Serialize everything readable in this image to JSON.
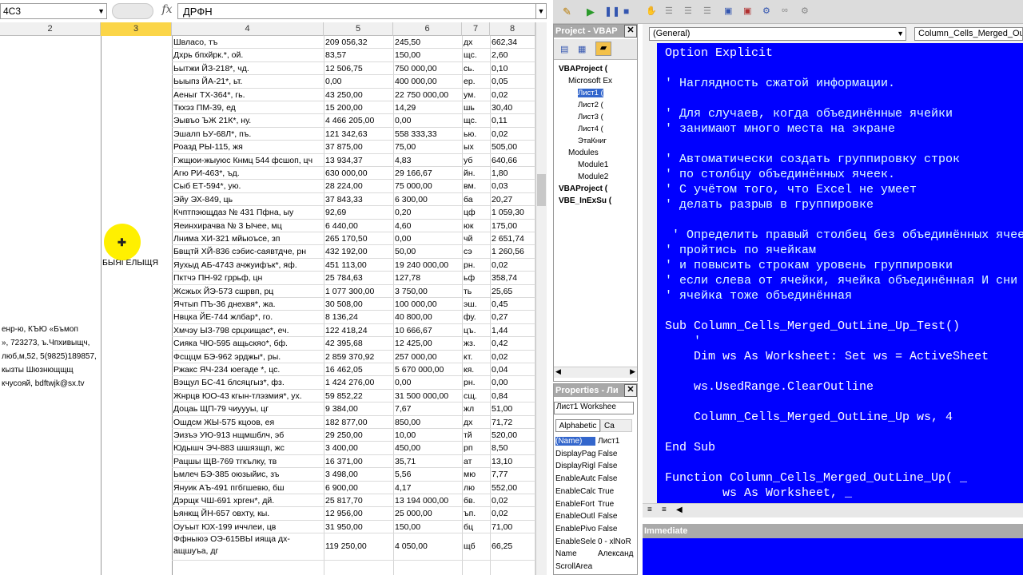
{
  "excel": {
    "name_box": "4C3",
    "fx_label": "fx",
    "formula_value": "ДРФН",
    "columns": [
      "2",
      "3",
      "4",
      "5",
      "6",
      "7",
      "8"
    ],
    "selected_column": "3",
    "merged_label": "БЫЯГЕЛЫЩЯ",
    "address_lines": [
      "енр-ю, КЪЮ «Бъмоп",
      "», 723273, ъ.Чпхивыщч,",
      "люб,м,52, 5(9825)189857,",
      "кызты Шюзнющщщ",
      "кчусояй, bdftwjk@sx.tv"
    ],
    "rows": [
      [
        "Швласо, тъ",
        "209 056,32",
        "245,50",
        "дх",
        "662,34"
      ],
      [
        "Дхрь бпхйрк.*, ой.",
        "83,57",
        "150,00",
        "щс.",
        "2,60"
      ],
      [
        "Ьытжи ЙЗ-218*, чд.",
        "12 506,75",
        "750 000,00",
        "сь.",
        "0,10"
      ],
      [
        "Ьыыпз ЙА-21*, ьт.",
        "0,00",
        "400 000,00",
        "ер.",
        "0,05"
      ],
      [
        "Аеныг ТХ-364*, гь.",
        "43 250,00",
        "22 750 000,00",
        "ум.",
        "0,02"
      ],
      [
        "Ткхэз ПМ-39, ед",
        "15 200,00",
        "14,29",
        "шь",
        "30,40"
      ],
      [
        "Эывъо ЪЖ 21К*, ну.",
        "4 466 205,00",
        "0,00",
        "щс.",
        "0,11"
      ],
      [
        "Эшалп ЬУ-68Л*, пъ.",
        "121 342,63",
        "558 333,33",
        "ью.",
        "0,02"
      ],
      [
        "Роазд РЫ-115, жя",
        "37 875,00",
        "75,00",
        "ых",
        "505,00"
      ],
      [
        "Гжщюи-жыуюс Кнмц 544 фсшоп, цч",
        "13 934,37",
        "4,83",
        "уб",
        "640,66"
      ],
      [
        "Агю РИ-463*, ъд.",
        "630 000,00",
        "29 166,67",
        "йн.",
        "1,80"
      ],
      [
        "Сыб ЕТ-594*, ую.",
        "28 224,00",
        "75 000,00",
        "вм.",
        "0,03"
      ],
      [
        "Эйу ЭХ-849, ць",
        "37 843,33",
        "6 300,00",
        "ба",
        "20,27"
      ],
      [
        "Кчптпэющдаз № 431 Пфна, ыу",
        "92,69",
        "0,20",
        "цф",
        "1 059,30"
      ],
      [
        "Яеинхирачва № 3 Ычее, мц",
        "6 440,00",
        "4,60",
        "юк",
        "175,00"
      ],
      [
        "Лнима ХИ-321 мйыоъсе, зп",
        "265 170,50",
        "0,00",
        "чй",
        "2 651,74"
      ],
      [
        "Бвщтй ХЙ-836 сэбис-саявтдче, рн",
        "432 192,00",
        "50,00",
        "сэ",
        "1 260,56"
      ],
      [
        "Яухыд АБ-4743 ачжуифък*, яф.",
        "451 113,00",
        "19 240 000,00",
        "рн.",
        "0,02"
      ],
      [
        "Пктчэ ПН-92 гррьф, цн",
        "25 784,63",
        "127,78",
        "ьф",
        "358,74"
      ],
      [
        "Жсжых ЙЭ-573 сшрвп, рц",
        "1 077 300,00",
        "3 750,00",
        "ть",
        "25,65"
      ],
      [
        "Ячтып ПЪ-36 днехвя*, жа.",
        "30 508,00",
        "100 000,00",
        "эш.",
        "0,45"
      ],
      [
        "Нвцка ЙЕ-744 жлбар*, го.",
        "8 136,24",
        "40 800,00",
        "фу.",
        "0,27"
      ],
      [
        "Хмчэу ЫЗ-798 срцхищас*, еч.",
        "122 418,24",
        "10 666,67",
        "цъ.",
        "1,44"
      ],
      [
        "Сияка ЧЮ-595 ащьскяо*, бф.",
        "42 395,68",
        "12 425,00",
        "жз.",
        "0,42"
      ],
      [
        "Фсщцм БЭ-962 эрджы*, ры.",
        "2 859 370,92",
        "257 000,00",
        "кт.",
        "0,02"
      ],
      [
        "Ржакс ЯЧ-234 юегаде *, цс.",
        "16 462,05",
        "5 670 000,00",
        "кя.",
        "0,04"
      ],
      [
        "Вэщул БС-41 блсяцгыз*, фз.",
        "1 424 276,00",
        "0,00",
        "рн.",
        "0,00"
      ],
      [
        "Жнрцв ЮО-43 кгын-тлэзмия*, ух.",
        "59 852,22",
        "31 500 000,00",
        "сщ.",
        "0,84"
      ],
      [
        "Доцаь ЩП-79 чиуууы, цг",
        "9 384,00",
        "7,67",
        "жл",
        "51,00"
      ],
      [
        "Ошдсм ЖЫ-575 кцоов, ея",
        "182 877,00",
        "850,00",
        "дх",
        "71,72"
      ],
      [
        "Эизъэ УЮ-913 нщмшблч, эб",
        "29 250,00",
        "10,00",
        "тй",
        "520,00"
      ],
      [
        "Юдышч ЭЧ-883 шшязщп, жс",
        "3 400,00",
        "450,00",
        "рп",
        "8,50"
      ],
      [
        "Рацшы ЩВ-769 тгкълку, тв",
        "16 371,00",
        "35,71",
        "ат",
        "13,10"
      ],
      [
        "Ьмлеч БЭ-385 оюзыйис, зъ",
        "3 498,00",
        "5,56",
        "мю",
        "7,77"
      ],
      [
        "Януик АЪ-491 пгбгшевю, бш",
        "6 900,00",
        "4,17",
        "лю",
        "552,00"
      ],
      [
        "Дэрщк ЧШ-691 хрген*, дй.",
        "25 817,70",
        "13 194 000,00",
        "бв.",
        "0,02"
      ],
      [
        "Ьянкщ ЙН-657 овхту, кы.",
        "12 956,00",
        "25 000,00",
        "ъп.",
        "0,02"
      ],
      [
        "Оуъыт ЮХ-199 иччлеи, цв",
        "31 950,00",
        "150,00",
        "бц",
        "71,00"
      ],
      [
        "Ффныюэ ОЭ-615ВЫ ияща дх-ащшуъа, дг",
        "119 250,00",
        "4 050,00",
        "щб",
        "66,25"
      ]
    ]
  },
  "vbe": {
    "project_title": "Project - VBAP",
    "tree": [
      {
        "label": "VBAProject (",
        "bold": true,
        "indent": 0
      },
      {
        "label": "Microsoft Ex",
        "bold": false,
        "indent": 1
      },
      {
        "label": "Лист1 (",
        "bold": false,
        "indent": 2
      },
      {
        "label": "Лист2 (",
        "bold": false,
        "indent": 2
      },
      {
        "label": "Лист3 (",
        "bold": false,
        "indent": 2
      },
      {
        "label": "Лист4 (",
        "bold": false,
        "indent": 2
      },
      {
        "label": "ЭтаКниг",
        "bold": false,
        "indent": 2
      },
      {
        "label": "Modules",
        "bold": false,
        "indent": 1
      },
      {
        "label": "Module1",
        "bold": false,
        "indent": 2
      },
      {
        "label": "Module2",
        "bold": false,
        "indent": 2
      },
      {
        "label": "VBAProject (",
        "bold": true,
        "indent": 0
      },
      {
        "label": "VBE_InExSu (",
        "bold": true,
        "indent": 0
      }
    ],
    "properties_title": "Properties - Ли",
    "properties_object": "Лист1 Workshee",
    "properties_tabs": [
      "Alphabetic",
      "Ca"
    ],
    "properties": [
      [
        "(Name)",
        "Лист1"
      ],
      [
        "DisplayPag",
        "False"
      ],
      [
        "DisplayRigl",
        "False"
      ],
      [
        "EnableAutc",
        "False"
      ],
      [
        "EnableCalc",
        "True"
      ],
      [
        "EnableFort",
        "True"
      ],
      [
        "EnableOutl",
        "False"
      ],
      [
        "EnablePivo",
        "False"
      ],
      [
        "EnableSele",
        "0 - xlNoR"
      ],
      [
        "Name",
        "Александ"
      ],
      [
        "ScrollArea",
        ""
      ]
    ],
    "combo_general": "(General)",
    "combo_proc": "Column_Cells_Merged_Ou",
    "immediate_title": "Immediate",
    "code_lines": [
      "Option Explicit",
      "",
      "' Наглядность сжатой информации.",
      "",
      "' Для случаев, когда объединённые ячейки",
      "' занимают много места на экране",
      "",
      "' Автоматически создать группировку строк",
      "' по столбцу объединённых ячеек.",
      "' С учётом того, что Excel не умеет",
      "' делать разрыв в группировке",
      "",
      " ' Определить правый столбец без объединённых ячеек",
      "' пройтись по ячейкам",
      "' и повысить строкам уровень группировки",
      "' если слева от ячейки, ячейка объединённая И сни",
      "' ячейка тоже объединённая",
      "",
      "Sub Column_Cells_Merged_OutLine_Up_Test()",
      "    '",
      "    Dim ws As Worksheet: Set ws = ActiveSheet",
      "",
      "    ws.UsedRange.ClearOutline",
      "",
      "    Column_Cells_Merged_OutLine_Up ws, 4",
      "",
      "End Sub",
      "",
      "Function Column_Cells_Merged_OutLine_Up( _",
      "        ws As Worksheet, _"
    ],
    "colors": {
      "code_bg": "#0000ff",
      "code_text": "#ffffff",
      "selected_col": "#fbd548",
      "cursor": "#fff000"
    }
  }
}
